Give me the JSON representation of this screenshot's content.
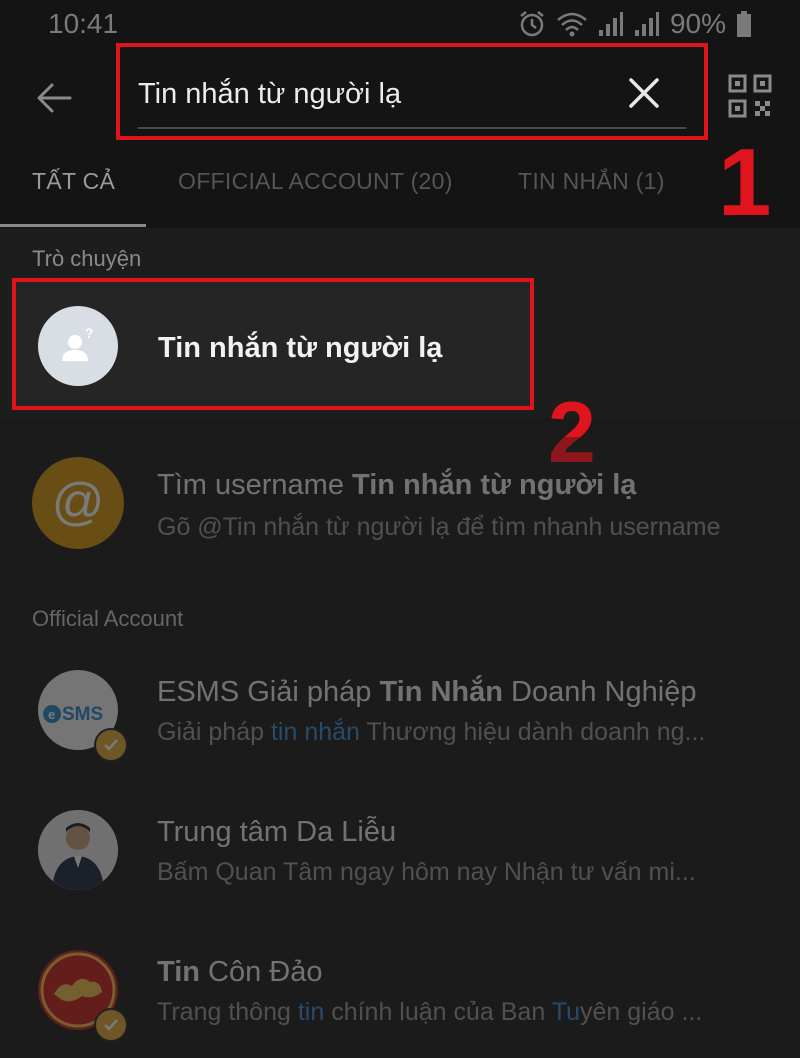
{
  "status": {
    "time": "10:41",
    "battery": "90%"
  },
  "search": {
    "query": "Tin nhắn từ người lạ"
  },
  "tabs": [
    {
      "label": "TẤT CẢ"
    },
    {
      "label": "OFFICIAL ACCOUNT (20)"
    },
    {
      "label": "TIN NHẮN (1)"
    }
  ],
  "annotations": {
    "step1": "1",
    "step2": "2"
  },
  "chat_section": {
    "label": "Trò chuyện",
    "item": {
      "name": "Tin nhắn từ người lạ"
    }
  },
  "username_search": {
    "title_prefix": "Tìm username ",
    "title_bold": "Tin nhắn từ người lạ",
    "subtitle": "Gõ @Tin nhắn từ người lạ để tìm nhanh username"
  },
  "official_section": {
    "label": "Official Account",
    "items": [
      {
        "title_a": "ESMS Giải pháp ",
        "title_b": "Tin Nhắn",
        "title_c": " Doanh Nghiệp",
        "sub_a": "Giải pháp ",
        "sub_b": "tin nhắn",
        "sub_c": " Thương hiệu dành doanh ng...",
        "avatar_text": "SMS"
      },
      {
        "title_a": "Trung tâm Da Liễu",
        "sub_a": "Bấm Quan Tâm ngay hôm nay Nhận tư vấn mi..."
      },
      {
        "title_a": "Tin",
        "title_b": " Côn Đảo",
        "sub_a": "Trang thông ",
        "sub_b": "tin",
        "sub_c": " chính luận của Ban ",
        "sub_d": "Tu",
        "sub_e": "yên giáo ..."
      }
    ]
  },
  "colors": {
    "highlight": "#e0141c",
    "link": "#3d8fd8",
    "verified": "#e5a93a"
  }
}
